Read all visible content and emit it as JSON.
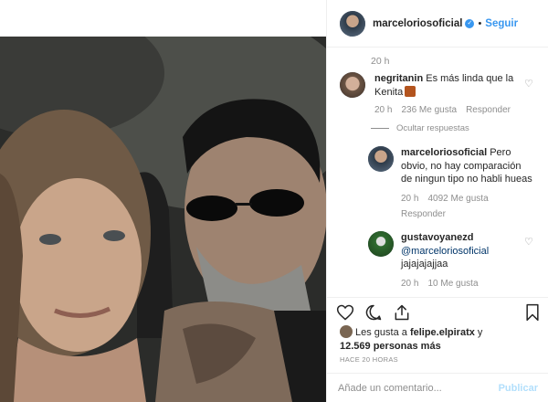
{
  "post": {
    "username": "marceloriosoficial",
    "verified_icon": "verified-badge-icon",
    "separator": "•",
    "follow_label": "Seguir"
  },
  "comments": {
    "top_time": "20 h",
    "items": [
      {
        "username": "negritanin",
        "text": "Es más linda que la Kenita",
        "time": "20 h",
        "likes": "236 Me gusta",
        "reply": "Responder"
      }
    ],
    "hide_replies": "Ocultar respuestas",
    "replies": [
      {
        "username": "marceloriosoficial",
        "text": "Pero obvio, no hay comparación de ningun tipo no habli hueas",
        "time": "20 h",
        "likes": "4092 Me gusta",
        "reply": "Responder"
      },
      {
        "username": "gustavoyanezd",
        "mention": "@marceloriosoficial",
        "text": "jajajajajjaa",
        "time": "20 h",
        "likes": "10 Me gusta"
      }
    ]
  },
  "actions": {
    "icons": [
      "heart-icon",
      "comment-icon",
      "share-icon",
      "bookmark-icon"
    ],
    "likes_prefix": "Les gusta a ",
    "likes_user": "felipe.elpiratx",
    "likes_mid": " y",
    "likes_count": "12.569 personas más",
    "ago": "HACE 20 HORAS",
    "comment_placeholder": "Añade un comentario...",
    "publish_label": "Publicar"
  },
  "colors": {
    "link_blue": "#3897f0",
    "publish_disabled": "#b2dffc",
    "meta_gray": "#8e8e8e"
  }
}
